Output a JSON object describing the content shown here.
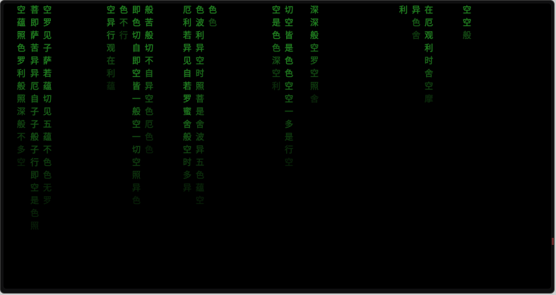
{
  "rain": {
    "color": "#1f7a1f",
    "columns": [
      {
        "text": "空蕴照色罗利般照深般不多空"
      },
      {
        "text": "菩即萨苦异异厄自子子般子行即空是色照"
      },
      {
        "text": "空罗见子萨若蕴切见五蕴不色色无罗"
      },
      {
        "text": "空异行观在利蕴"
      },
      {
        "text": "色不行"
      },
      {
        "text": "般苦般切不自异空色厄色色"
      },
      {
        "text": "即色切自即空皆一般空一切空照异色"
      },
      {
        "text": "厄利若异见自若罗蜜舍般空时多异"
      },
      {
        "text": "色波利异空时照菩是舍波异五色蕴空"
      },
      {
        "text": "色色"
      },
      {
        "text": "空是色色深空利"
      },
      {
        "text": "切空皆是色色空空一多是行空"
      },
      {
        "text": "深深般空罗空照舍"
      },
      {
        "text": "利"
      },
      {
        "text": "异色舍"
      },
      {
        "text": "在厄观利时舍空摩"
      },
      {
        "text": "空空般"
      }
    ]
  }
}
